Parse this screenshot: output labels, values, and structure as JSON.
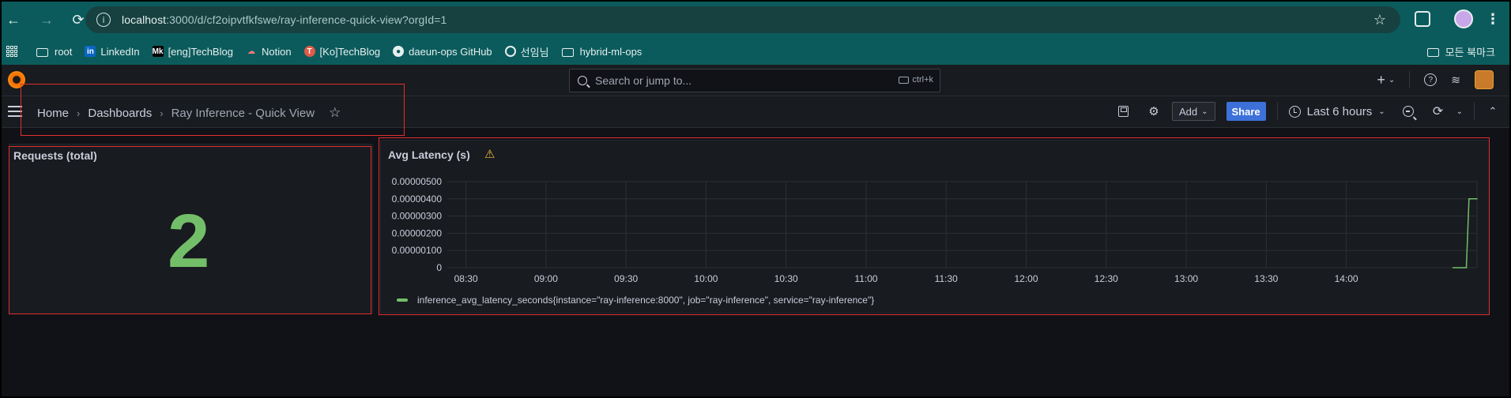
{
  "browser": {
    "url_host": "localhost",
    "url_rest": ":3000/d/cf2oipvtfkfswe/ray-inference-quick-view?orgId=1",
    "bookmarks": [
      {
        "label": "root",
        "icon": "folder-icon"
      },
      {
        "label": "LinkedIn",
        "icon": "linkedin-icon",
        "glyph": "in"
      },
      {
        "label": "[eng]TechBlog",
        "icon": "mk-icon",
        "glyph": "Mk"
      },
      {
        "label": "Notion",
        "icon": "notion-icon",
        "glyph": "☁"
      },
      {
        "label": "[Ko]TechBlog",
        "icon": "techblog-icon",
        "glyph": "T"
      },
      {
        "label": "daeun-ops GitHub",
        "icon": "github-icon",
        "glyph": "●"
      },
      {
        "label": "선임님",
        "icon": "ring-icon",
        "glyph": ""
      },
      {
        "label": "hybrid-ml-ops",
        "icon": "folder-icon"
      }
    ],
    "all_bookmarks_label": "모든 북마크"
  },
  "grafana": {
    "search_placeholder": "Search or jump to...",
    "search_shortcut": "ctrl+k",
    "breadcrumb": {
      "home": "Home",
      "dashboards": "Dashboards",
      "current": "Ray Inference - Quick View"
    },
    "toolbar": {
      "add_label": "Add",
      "share_label": "Share",
      "time_range": "Last 6 hours"
    },
    "accent_color": "#3d71d9"
  },
  "panels": {
    "requests": {
      "title": "Requests (total)",
      "value": "2",
      "color": "#73bf69"
    },
    "latency": {
      "title": "Avg Latency (s)",
      "warning": true,
      "legend": "inference_avg_latency_seconds{instance=\"ray-inference:8000\", job=\"ray-inference\", service=\"ray-inference\"}"
    }
  },
  "chart_data": {
    "type": "line",
    "title": "Avg Latency (s)",
    "xlabel": "",
    "ylabel": "",
    "x_ticks": [
      "08:30",
      "09:00",
      "09:30",
      "10:00",
      "10:30",
      "11:00",
      "11:30",
      "12:00",
      "12:30",
      "13:00",
      "13:30",
      "14:00"
    ],
    "y_ticks": [
      "0",
      "0.00000100",
      "0.00000200",
      "0.00000300",
      "0.00000400",
      "0.00000500"
    ],
    "ylim": [
      0,
      5e-06
    ],
    "xlim": [
      "08:23",
      "14:49"
    ],
    "grid": true,
    "legend_position": "bottom-left",
    "series": [
      {
        "name": "inference_avg_latency_seconds{instance=\"ray-inference:8000\", job=\"ray-inference\", service=\"ray-inference\"}",
        "color": "#73bf69",
        "x": [
          "14:40",
          "14:45",
          "14:46",
          "14:49"
        ],
        "y": [
          0,
          0,
          4e-06,
          4e-06
        ]
      }
    ]
  }
}
